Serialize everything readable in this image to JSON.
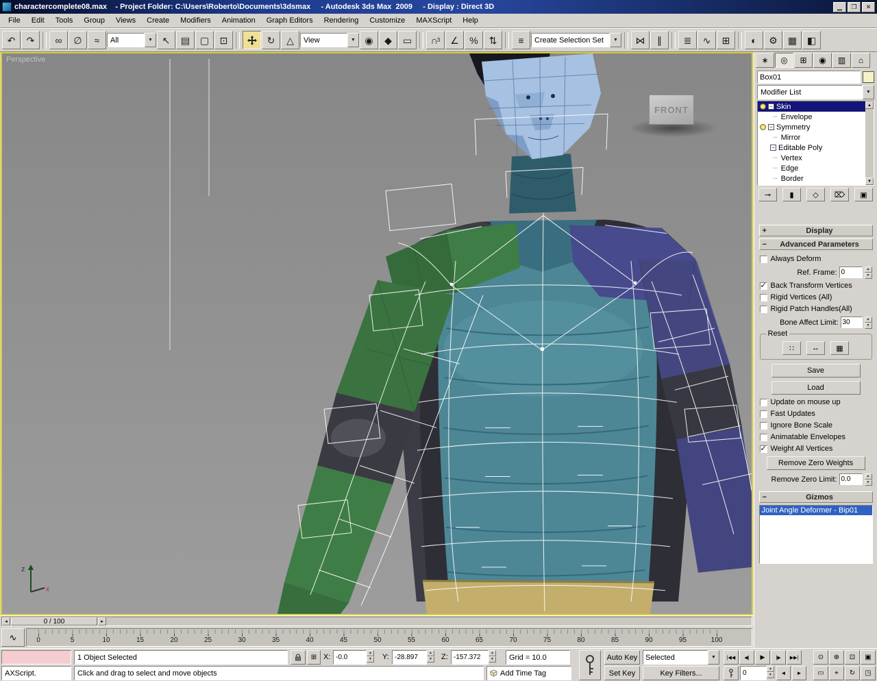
{
  "titlebar": {
    "title": "charactercomplete08.max    - Project Folder: C:\\Users\\Roberto\\Documents\\3dsmax     - Autodesk 3ds Max  2009     - Display : Direct 3D"
  },
  "menubar": {
    "items": [
      "File",
      "Edit",
      "Tools",
      "Group",
      "Views",
      "Create",
      "Modifiers",
      "Animation",
      "Graph Editors",
      "Rendering",
      "Customize",
      "MAXScript",
      "Help"
    ]
  },
  "toolbar": {
    "selection_filter": "All",
    "coord_system": "View",
    "selection_set_label": "Create Selection Set",
    "snap_superscript": "3"
  },
  "viewport": {
    "label": "Perspective",
    "view_gizmo": "FRONT",
    "axis_z_label": "z",
    "axis_x_label": "x"
  },
  "timeline": {
    "slider_value": "0 / 100",
    "tick_labels": [
      "0",
      "5",
      "10",
      "15",
      "20",
      "25",
      "30",
      "35",
      "40",
      "45",
      "50",
      "55",
      "60",
      "65",
      "70",
      "75",
      "80",
      "85",
      "90",
      "95",
      "100"
    ]
  },
  "command_panel": {
    "object_name": "Box01",
    "modifier_list_label": "Modifier List",
    "stack_items": {
      "skin": "Skin",
      "envelope": "Envelope",
      "symmetry": "Symmetry",
      "mirror": "Mirror",
      "editable_poly": "Editable Poly",
      "vertex": "Vertex",
      "edge": "Edge",
      "border": "Border"
    },
    "rollouts": {
      "display": "Display",
      "advanced": "Advanced Parameters",
      "gizmos": "Gizmos"
    },
    "advanced": {
      "always_deform": "Always Deform",
      "ref_frame_label": "Ref. Frame:",
      "ref_frame_value": "0",
      "back_transform": "Back Transform Vertices",
      "rigid_vertices": "Rigid Vertices (All)",
      "rigid_patch": "Rigid Patch Handles(All)",
      "bone_affect_label": "Bone Affect Limit:",
      "bone_affect_value": "30",
      "reset_group_label": "Reset",
      "save_button": "Save",
      "load_button": "Load",
      "update_mouse": "Update on mouse up",
      "fast_updates": "Fast Updates",
      "ignore_bone_scale": "Ignore Bone Scale",
      "animatable_envelopes": "Animatable Envelopes",
      "weight_all": "Weight All Vertices",
      "remove_zero_button": "Remove Zero Weights",
      "remove_zero_label": "Remove Zero Limit:",
      "remove_zero_value": "0.0"
    },
    "checks": {
      "always_deform": false,
      "back_transform": true,
      "rigid_vertices": false,
      "rigid_patch": false,
      "update_mouse": false,
      "fast_updates": false,
      "ignore_bone_scale": false,
      "animatable_envelopes": false,
      "weight_all": true
    },
    "gizmos_list": {
      "selected_item": "Joint Angle Deformer - Bip01"
    }
  },
  "statusbar": {
    "listener_text": "AXScript.",
    "selection_status": "1 Object Selected",
    "x_label": "X:",
    "x_value": "-0.0",
    "y_label": "Y:",
    "y_value": "-28.897",
    "z_label": "Z:",
    "z_value": "-157.372",
    "grid_value": "Grid = 10.0",
    "prompt": "Click and drag to select and move objects",
    "add_time_tag": "Add Time Tag",
    "auto_key": "Auto Key",
    "set_key": "Set Key",
    "selected_filter": "Selected",
    "key_filters": "Key Filters...",
    "frame_value": "0"
  },
  "colors": {
    "stack_selection": "#14147a",
    "gizmo_selection": "#2f62c1",
    "viewport_border": "#d8cf3a",
    "macro_recorder_pink": "#f5cdd1",
    "object_color_swatch": "#f6f2c8",
    "active_tool_highlight": "#efe093"
  }
}
